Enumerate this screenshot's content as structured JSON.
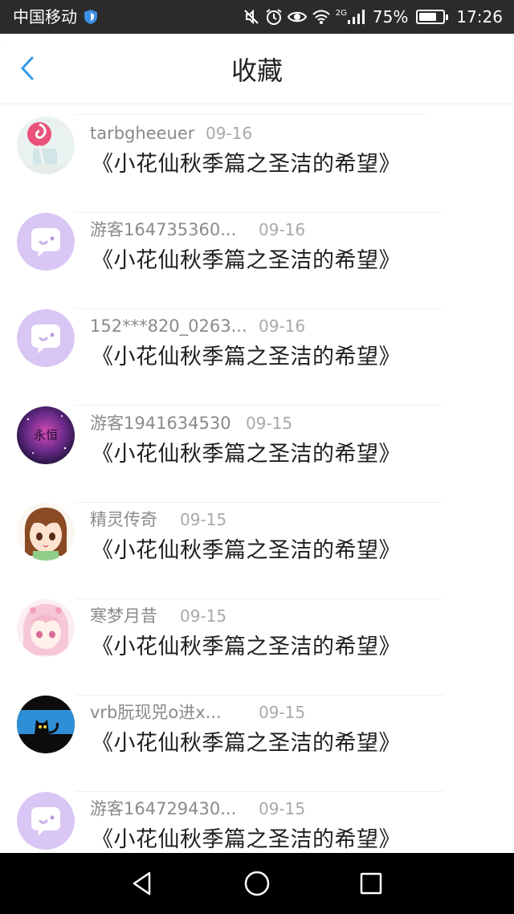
{
  "status_bar": {
    "carrier": "中国移动",
    "network": "2G",
    "battery": "75%",
    "battery_level": 0.75,
    "time": "17:26",
    "icons": [
      "shield-icon",
      "mute-icon",
      "alarm-icon",
      "eye-icon",
      "wifi-icon",
      "signal-icon",
      "battery-icon"
    ]
  },
  "header": {
    "back_icon": "chevron-left-icon",
    "title": "收藏",
    "accent_color": "#2f9bea"
  },
  "favorites": [
    {
      "user": "tarbgheeuer",
      "date": "09-16",
      "title": "《小花仙秋季篇之圣洁的希望》",
      "avatar": "lollipop-avatar"
    },
    {
      "user": "游客164735360...",
      "date": "09-16",
      "title": "《小花仙秋季篇之圣洁的希望》",
      "avatar": "default-chat-avatar"
    },
    {
      "user": "152***820_0263...",
      "date": "09-16",
      "title": "《小花仙秋季篇之圣洁的希望》",
      "avatar": "default-chat-avatar"
    },
    {
      "user": "游客1941634530",
      "date": "09-15",
      "title": "《小花仙秋季篇之圣洁的希望》",
      "avatar": "galaxy-avatar",
      "avatar_text": "永恒"
    },
    {
      "user": "精灵传奇",
      "date": "09-15",
      "title": "《小花仙秋季篇之圣洁的希望》",
      "avatar": "anime-girl-brown-avatar"
    },
    {
      "user": "寒梦月昔",
      "date": "09-15",
      "title": "《小花仙秋季篇之圣洁的希望》",
      "avatar": "anime-girl-pink-avatar"
    },
    {
      "user": "vrb朊现兕o进x...",
      "date": "09-15",
      "title": "《小花仙秋季篇之圣洁的希望》",
      "avatar": "black-cat-avatar"
    },
    {
      "user": "游客164729430...",
      "date": "09-15",
      "title": "《小花仙秋季篇之圣洁的希望》",
      "avatar": "default-chat-avatar"
    }
  ],
  "nav_bar": {
    "buttons": [
      "back-triangle-icon",
      "home-circle-icon",
      "recents-square-icon"
    ]
  },
  "colors": {
    "status_bar_bg": "#2b2b2b",
    "default_avatar": "#d9c6f4",
    "name_text": "#8a8a8a",
    "title_text": "#1f1f1f"
  }
}
